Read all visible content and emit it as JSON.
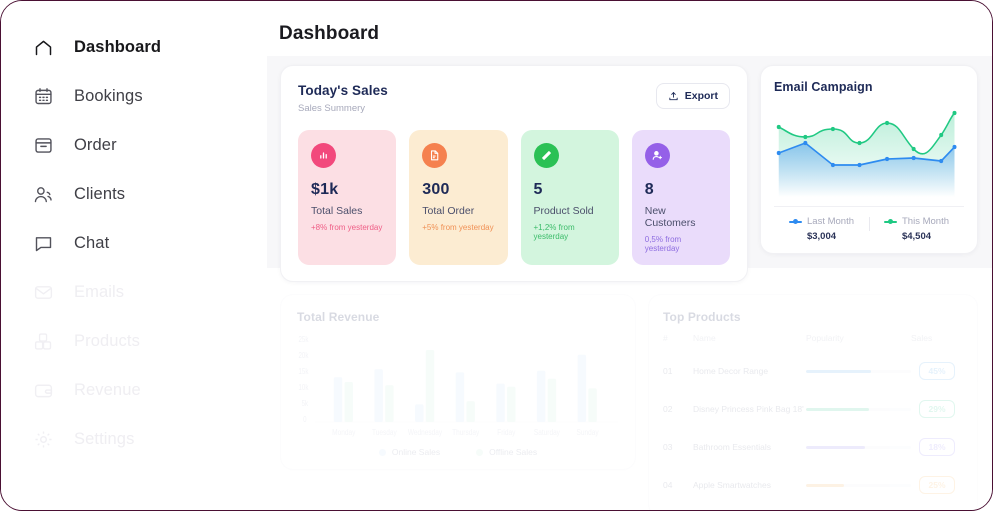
{
  "sidebar": {
    "items": [
      {
        "label": "Dashboard",
        "icon": "home-icon",
        "active": true,
        "dim": false
      },
      {
        "label": "Bookings",
        "icon": "calendar-icon",
        "active": false,
        "dim": false
      },
      {
        "label": "Order",
        "icon": "archive-icon",
        "active": false,
        "dim": false
      },
      {
        "label": "Clients",
        "icon": "users-icon",
        "active": false,
        "dim": false
      },
      {
        "label": "Chat",
        "icon": "chat-icon",
        "active": false,
        "dim": false
      },
      {
        "label": "Emails",
        "icon": "mail-icon",
        "active": false,
        "dim": true
      },
      {
        "label": "Products",
        "icon": "boxes-icon",
        "active": false,
        "dim": true
      },
      {
        "label": "Revenue",
        "icon": "wallet-icon",
        "active": false,
        "dim": true
      },
      {
        "label": "Settings",
        "icon": "gear-icon",
        "active": false,
        "dim": true
      }
    ]
  },
  "header": {
    "title": "Dashboard"
  },
  "sales": {
    "title": "Today's Sales",
    "subtitle": "Sales Summery",
    "export_label": "Export",
    "stats": [
      {
        "value": "$1k",
        "label": "Total Sales",
        "delta": "+8% from yesterday",
        "icon": "bar-chart-icon",
        "bg": "#fcdfe4",
        "badge": "#f2497c",
        "delta_color": "#ef5e86"
      },
      {
        "value": "300",
        "label": "Total Order",
        "delta": "+5% from yesterday",
        "icon": "receipt-icon",
        "bg": "#fcecd2",
        "badge": "#f5814f",
        "delta_color": "#f09156"
      },
      {
        "value": "5",
        "label": "Product Sold",
        "delta": "+1,2% from yesterday",
        "icon": "tag-icon",
        "bg": "#d3f5de",
        "badge": "#2bc155",
        "delta_color": "#3cbc6a"
      },
      {
        "value": "8",
        "label": "New Customers",
        "delta": "0,5% from yesterday",
        "icon": "user-plus-icon",
        "bg": "#eadcfb",
        "badge": "#9560e8",
        "delta_color": "#8e6de0"
      }
    ]
  },
  "email": {
    "title": "Email Campaign",
    "legend": [
      {
        "name": "Last Month",
        "value": "$3,004",
        "color": "#2e8bf0"
      },
      {
        "name": "This Month",
        "value": "$4,504",
        "color": "#1fc983"
      }
    ]
  },
  "revenue": {
    "title": "Total Revenue",
    "legend": [
      {
        "name": "Online Sales",
        "color": "#cde3fb"
      },
      {
        "name": "Offline Sales",
        "color": "#cff2e0"
      }
    ]
  },
  "products": {
    "title": "Top Products",
    "columns": [
      "#",
      "Name",
      "Popularity",
      "Sales"
    ],
    "rows": [
      {
        "num": "01",
        "name": "Home Decor Range",
        "popularity": 62,
        "sales": "45%",
        "color": "#6fb5f0"
      },
      {
        "num": "02",
        "name": "Disney Princess Pink Bag 18'",
        "popularity": 60,
        "sales": "29%",
        "color": "#4fcf9e"
      },
      {
        "num": "03",
        "name": "Bathroom Essentials",
        "popularity": 56,
        "sales": "18%",
        "color": "#9b8ef0"
      },
      {
        "num": "04",
        "name": "Apple Smartwatches",
        "popularity": 36,
        "sales": "25%",
        "color": "#f5b765"
      }
    ]
  },
  "chart_data": [
    {
      "type": "area",
      "title": "Email Campaign",
      "x": [
        1,
        2,
        3,
        4,
        5,
        6,
        7,
        8
      ],
      "series": [
        {
          "name": "This Month",
          "color": "#1fc983",
          "total": "$4,504",
          "values": [
            68,
            58,
            64,
            50,
            70,
            62,
            44,
            86
          ]
        },
        {
          "name": "Last Month",
          "color": "#2e8bf0",
          "total": "$3,004",
          "values": [
            38,
            50,
            24,
            24,
            32,
            33,
            32,
            48
          ]
        }
      ],
      "grid": false,
      "legend_position": "bottom",
      "xlabel": "",
      "ylabel": ""
    },
    {
      "type": "bar",
      "title": "Total Revenue",
      "categories": [
        "Monday",
        "Tuesday",
        "Wednesday",
        "Thursday",
        "Friday",
        "Saturday",
        "Sunday"
      ],
      "series": [
        {
          "name": "Online Sales",
          "color": "#cde3fb",
          "values": [
            14000,
            16500,
            5500,
            15500,
            12000,
            16000,
            21000
          ]
        },
        {
          "name": "Offline Sales",
          "color": "#cff2e0",
          "values": [
            12500,
            11500,
            22500,
            6500,
            11000,
            13500,
            10500
          ]
        }
      ],
      "ylim": [
        0,
        25000
      ],
      "yticks": [
        "0",
        "5k",
        "10k",
        "15k",
        "20k",
        "25k"
      ],
      "grid": false,
      "legend_position": "bottom",
      "xlabel": "",
      "ylabel": ""
    }
  ]
}
